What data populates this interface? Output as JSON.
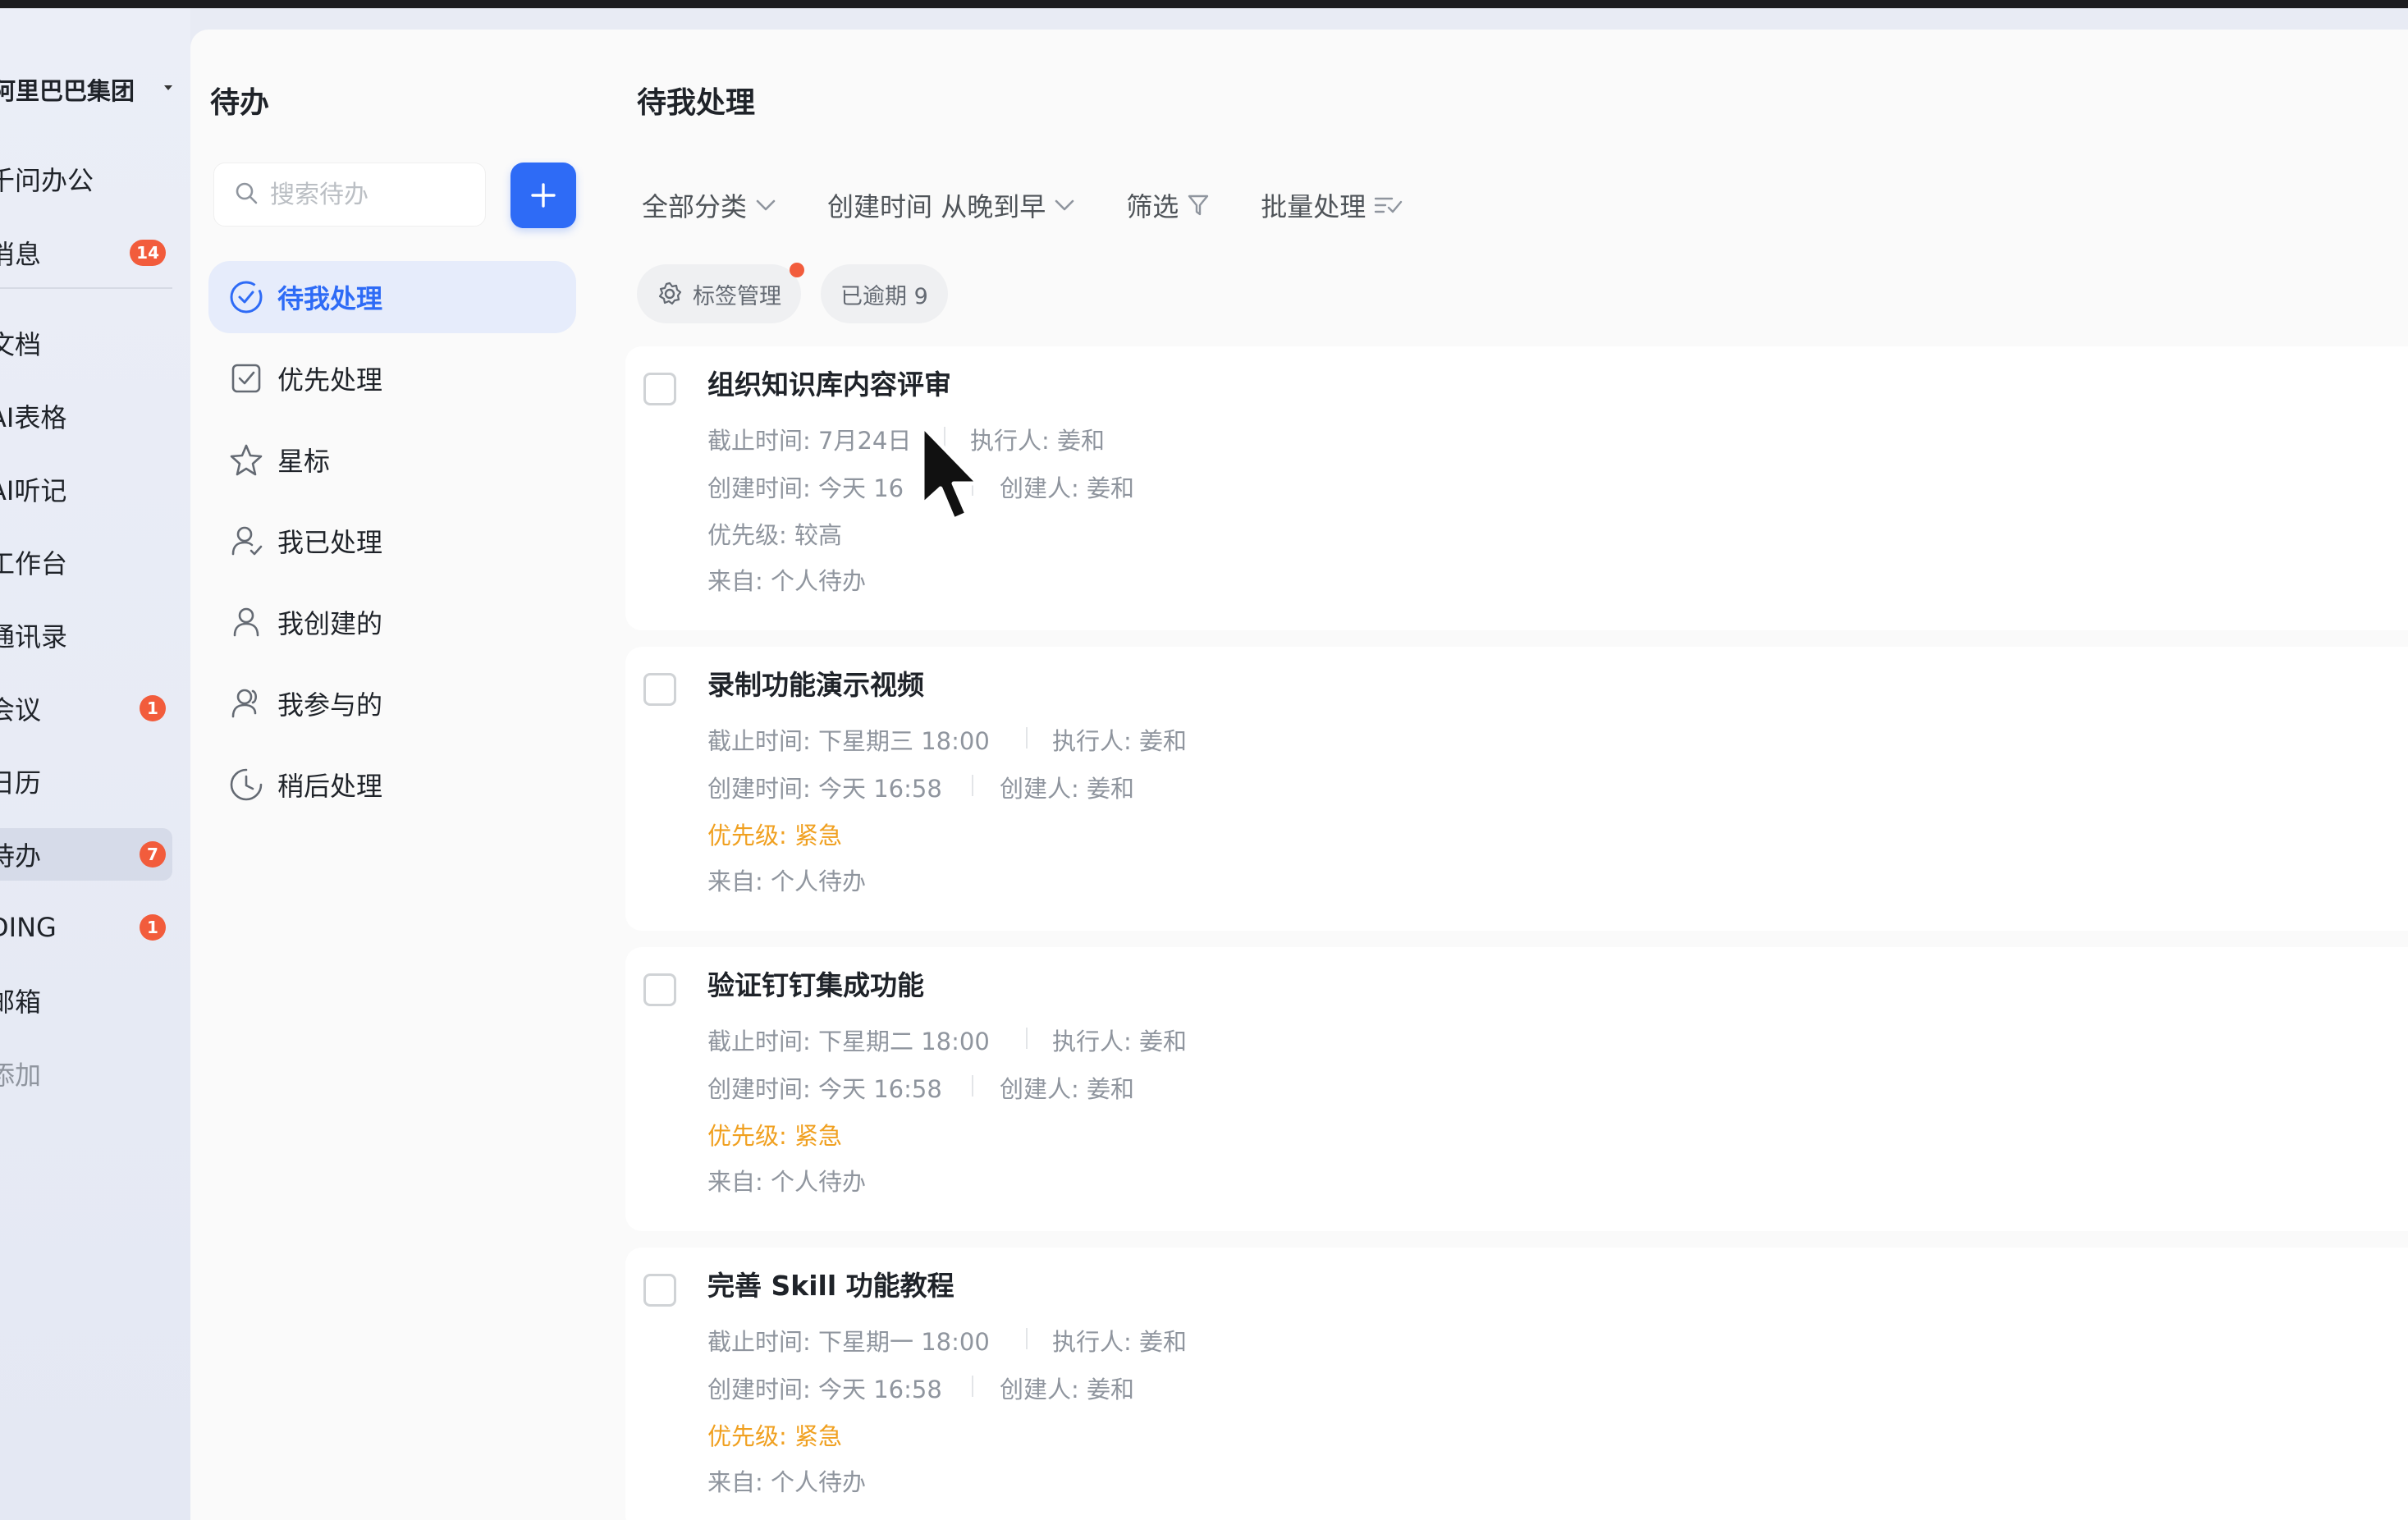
{
  "app_nav": {
    "org_name": "阿里巴巴集团",
    "items": [
      {
        "label": "千问办公"
      },
      {
        "label": "消息",
        "badge": "14"
      },
      {
        "label": "文档"
      },
      {
        "label": "AI表格"
      },
      {
        "label": "AI听记"
      },
      {
        "label": "工作台"
      },
      {
        "label": "通讯录"
      },
      {
        "label": "会议",
        "badge": "1"
      },
      {
        "label": "日历"
      },
      {
        "label": "待办",
        "badge": "7"
      },
      {
        "label": "DING",
        "badge": "1"
      },
      {
        "label": "邮箱"
      },
      {
        "label": "添加"
      }
    ]
  },
  "sidebar": {
    "title": "待办",
    "search_placeholder": "搜索待办",
    "menu": [
      {
        "label": "待我处理",
        "icon": "circle-check-icon"
      },
      {
        "label": "优先处理",
        "icon": "square-check-icon"
      },
      {
        "label": "星标",
        "icon": "star-icon"
      },
      {
        "label": "我已处理",
        "icon": "user-check-icon"
      },
      {
        "label": "我创建的",
        "icon": "user-icon"
      },
      {
        "label": "我参与的",
        "icon": "user-group-icon"
      },
      {
        "label": "稍后处理",
        "icon": "clock-icon"
      }
    ]
  },
  "main": {
    "title": "待我处理",
    "toolbar": {
      "category": "全部分类",
      "sort": "创建时间 从晚到早",
      "filter": "筛选",
      "batch": "批量处理"
    },
    "chips": {
      "tag_manage": "标签管理",
      "overdue": "已逾期 9"
    },
    "todos": [
      {
        "title": "组织知识库内容评审",
        "deadline": "截止时间: 7月24日",
        "assignee": "执行人: 姜和",
        "created": "创建时间: 今天 16",
        "creator": "创建人: 姜和",
        "priority": "优先级: 较高",
        "source": "来自: 个人待办"
      },
      {
        "title": "录制功能演示视频",
        "deadline": "截止时间: 下星期三 18:00",
        "assignee": "执行人: 姜和",
        "created": "创建时间: 今天 16:58",
        "creator": "创建人: 姜和",
        "priority": "优先级: 紧急",
        "source": "来自: 个人待办"
      },
      {
        "title": "验证钉钉集成功能",
        "deadline": "截止时间: 下星期二 18:00",
        "assignee": "执行人: 姜和",
        "created": "创建时间: 今天 16:58",
        "creator": "创建人: 姜和",
        "priority": "优先级: 紧急",
        "source": "来自: 个人待办"
      },
      {
        "title": "完善 Skill 功能教程",
        "deadline": "截止时间: 下星期一 18:00",
        "assignee": "执行人: 姜和",
        "created": "创建时间: 今天 16:58",
        "creator": "创建人: 姜和",
        "priority": "优先级: 紧急",
        "source": "来自: 个人待办"
      }
    ]
  },
  "colors": {
    "accent": "#2e6bf6",
    "badge": "#f25c3c",
    "urgent": "#f0a020"
  }
}
